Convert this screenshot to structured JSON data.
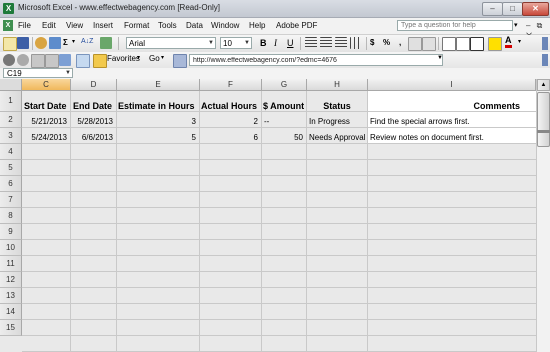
{
  "window": {
    "title": "Microsoft Excel - www.effectwebagency.com  [Read-Only]",
    "controls": {
      "minimize": "–",
      "maximize": "□",
      "close": "✕"
    }
  },
  "menu": {
    "items": [
      "File",
      "Edit",
      "View",
      "Insert",
      "Format",
      "Tools",
      "Data",
      "Window",
      "Help",
      "Adobe PDF"
    ],
    "help_placeholder": "Type a question for help",
    "mdi_controls": "– ⧉ ✕"
  },
  "toolbar": {
    "font": "Arial",
    "size": "10",
    "bold": "B",
    "italic": "I",
    "underline": "U",
    "sigma": "Σ",
    "currency": "$",
    "percent": "%",
    "comma": ",",
    "sort": "A↓Z",
    "font_color": "A"
  },
  "webbar": {
    "favorites": "Favorites",
    "go": "Go",
    "address": "http://www.effectwebagency.com/?edmc=4676"
  },
  "namebox": {
    "value": "C19"
  },
  "columns": [
    "C",
    "D",
    "E",
    "F",
    "G",
    "H",
    "I"
  ],
  "selected_column": "C",
  "rows": [
    "1",
    "2",
    "3",
    "4",
    "5",
    "6",
    "7",
    "8",
    "9",
    "10",
    "11",
    "12",
    "13",
    "14",
    "15"
  ],
  "headers": {
    "start_date": "Start Date",
    "end_date": "End Date",
    "estimate": "Estimate in Hours",
    "actual": "Actual Hours",
    "amount": "$ Amount",
    "status": "Status",
    "comments": "Comments"
  },
  "data_rows": [
    {
      "start_date": "5/21/2013",
      "end_date": "5/28/2013",
      "estimate": "3",
      "actual": "2",
      "amount": "--",
      "status": "In Progress",
      "comments": "Find the special arrows first."
    },
    {
      "start_date": "5/24/2013",
      "end_date": "6/6/2013",
      "estimate": "5",
      "actual": "6",
      "amount": "50",
      "status": "Needs Approval",
      "comments": "Review notes on document first."
    }
  ],
  "colors": {
    "selected_header": "#f0b85c",
    "grid_bg": "#e9e9e9",
    "close_button": "#c8483a"
  }
}
